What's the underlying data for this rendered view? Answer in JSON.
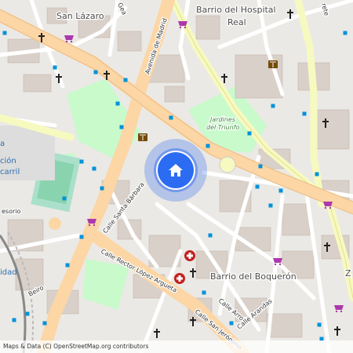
{
  "places": {
    "san_lazaro": "San Lázaro",
    "barrio_hospital_1": "Barrio del Hospital",
    "barrio_hospital_2": "Real",
    "barrio_boqueron": "Barrio del Boquerón",
    "jardines_1": "Jardines",
    "jardines_2": "del Triunfo",
    "carril_1": "a",
    "carril_2": "ción",
    "carril_3": "carril",
    "idad": "idad",
    "z_label": "Z"
  },
  "streets": {
    "avenida_madrid": "Avenida de Madrid",
    "calle_santa_barbara": "Calle Santa Bárbara",
    "calle_rector": "Calle Rector López Argueta",
    "calle_san_jeronimo": "Calle San Jerónimo",
    "calle_arrola": "Calle Arrola",
    "calle_arandas": "Calle Arandas",
    "gea": "Gea",
    "rete": "rete",
    "esorio": "esorio",
    "beiro": "Beiro"
  },
  "icons": [
    "church-icon",
    "library-icon",
    "shopping-icon",
    "hospital-icon",
    "bus-stop-icon",
    "home-icon"
  ],
  "colors": {
    "primary_road": "#fcd6a4",
    "secondary_road": "#f7fabf",
    "park": "#c8facc",
    "building": "#d9d0c9",
    "location": "#2c6cf2"
  },
  "attribution": "Maps & Data (C) OpenStreetMap.org contributors"
}
